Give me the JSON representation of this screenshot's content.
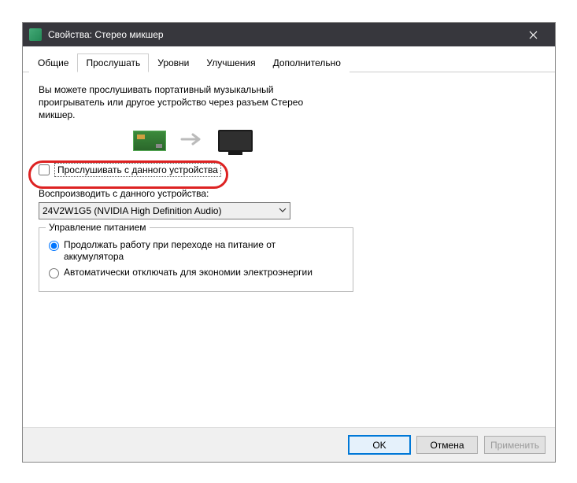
{
  "window": {
    "title": "Свойства: Стерео микшер"
  },
  "tabs": {
    "general": "Общие",
    "listen": "Прослушать",
    "levels": "Уровни",
    "enhancements": "Улучшения",
    "advanced": "Дополнительно"
  },
  "listen_tab": {
    "description": "Вы можете прослушивать портативный музыкальный проигрыватель или другое устройство через разъем Стерео микшер.",
    "listen_checkbox_label": "Прослушивать с данного устройства",
    "listen_checked": false,
    "play_through_label": "Воспроизводить с данного устройства:",
    "selected_device": "24V2W1G5 (NVIDIA High Definition Audio)",
    "power_group_legend": "Управление питанием",
    "power_option_continue": "Продолжать работу при переходе на питание от аккумулятора",
    "power_option_auto_off": "Автоматически отключать для экономии электроэнергии",
    "power_selected": "continue"
  },
  "buttons": {
    "ok": "OK",
    "cancel": "Отмена",
    "apply": "Применить"
  }
}
